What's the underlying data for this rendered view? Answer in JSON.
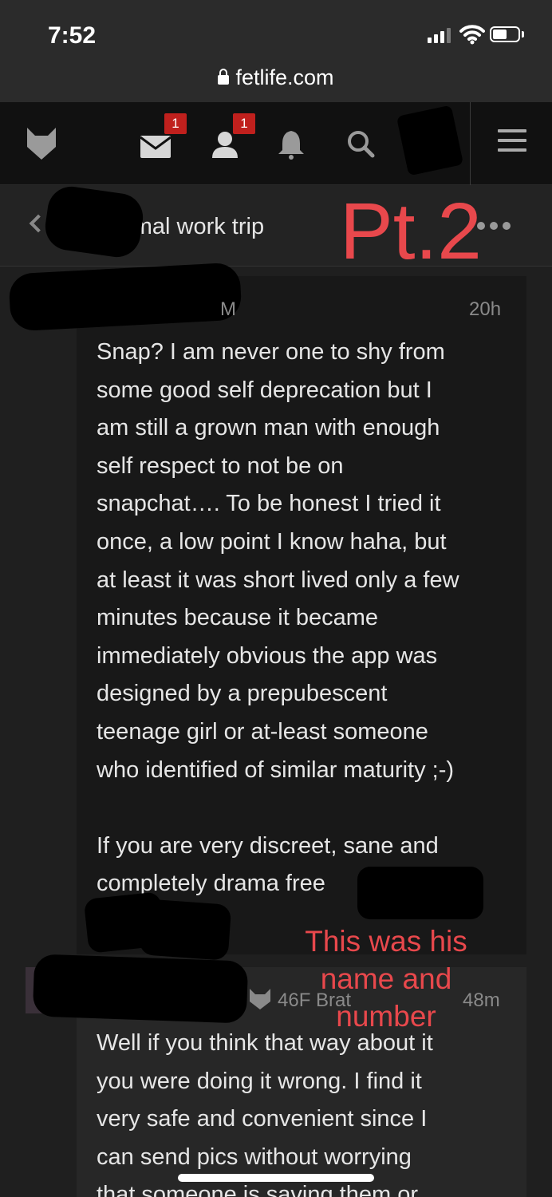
{
  "status_bar": {
    "time": "7:52",
    "url": "fetlife.com"
  },
  "nav": {
    "messages_badge": "1",
    "requests_badge": "1",
    "icons": [
      "fetlife-logo-icon",
      "mail-icon",
      "user-icon",
      "bell-icon",
      "search-icon",
      "menu-icon"
    ]
  },
  "conversation": {
    "title": "roximal work trip",
    "annotation": "Pt.2"
  },
  "messages": [
    {
      "age": "M",
      "time": "20h",
      "body": "Snap? I am never one to shy from\nsome good self deprecation but I\nam still a grown man with enough\nself respect to not be on\nsnapchat…. To be honest I tried it\nonce, a low point I know haha, but\nat least it was short lived only a few\nminutes because it became\nimmediately obvious the app was\ndesigned by a prepubescent\nteenage girl or at-least someone\nwho identified of similar maturity ;-)\n\nIf you are very discreet, sane and\ncompletely drama free"
    },
    {
      "age": "46F Brat",
      "time": "48m",
      "body": "Well if you think that way about it\nyou were doing it wrong. I find it\nvery safe and convenient since I\ncan send pics without worrying\nthat someone is saving them or"
    }
  ],
  "annotation_note": "This was his\nname and\nnumber",
  "colors": {
    "accent": "#e8484c",
    "badge": "#c0201d",
    "background": "#1f1f1f"
  }
}
